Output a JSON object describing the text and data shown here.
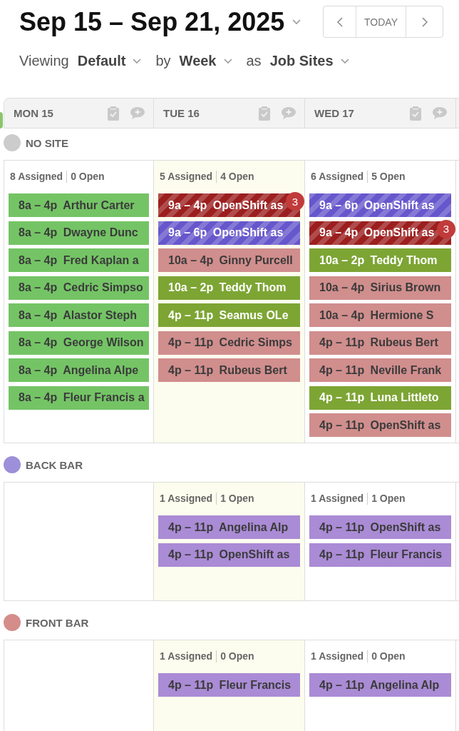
{
  "header": {
    "title": "Sep 15 – Sep 21, 2025",
    "today_button": "TODAY"
  },
  "filters": [
    {
      "label": "Viewing",
      "value": "Default"
    },
    {
      "label": "by",
      "value": "Week"
    },
    {
      "label": "as",
      "value": "Job Sites"
    }
  ],
  "days": [
    {
      "label": "MON 15",
      "today": false
    },
    {
      "label": "TUE 16",
      "today": true
    },
    {
      "label": "WED 17",
      "today": false
    }
  ],
  "sites": [
    {
      "name": "NO SITE",
      "color": "#cccccc",
      "cells": [
        {
          "assigned": "8 Assigned",
          "open": "0 Open",
          "shifts": [
            {
              "time": "8a – 4p",
              "title": "Arthur Carter",
              "color": "#74c465",
              "open_shift": false
            },
            {
              "time": "8a – 4p",
              "title": "Dwayne Dunc",
              "color": "#74c465",
              "open_shift": false
            },
            {
              "time": "8a – 4p",
              "title": "Fred Kaplan a",
              "color": "#74c465",
              "open_shift": false
            },
            {
              "time": "8a – 4p",
              "title": "Cedric Simpso",
              "color": "#74c465",
              "open_shift": false
            },
            {
              "time": "8a – 4p",
              "title": "Alastor Steph",
              "color": "#74c465",
              "open_shift": false
            },
            {
              "time": "8a – 4p",
              "title": "George Wilson",
              "color": "#74c465",
              "open_shift": false
            },
            {
              "time": "8a – 4p",
              "title": "Angelina Alpe",
              "color": "#74c465",
              "open_shift": false
            },
            {
              "time": "8a – 4p",
              "title": "Fleur Francis a",
              "color": "#74c465",
              "open_shift": false
            }
          ]
        },
        {
          "assigned": "5 Assigned",
          "open": "4 Open",
          "shifts": [
            {
              "time": "9a – 4p",
              "title": "OpenShift as",
              "color": "#9c1f1f",
              "open_shift": true,
              "badge": "3"
            },
            {
              "time": "9a – 6p",
              "title": "OpenShift as",
              "color": "#6657cc",
              "open_shift": true
            },
            {
              "time": "10a – 4p",
              "title": "Ginny Purcell",
              "color": "#d08e8d",
              "open_shift": false
            },
            {
              "time": "10a – 2p",
              "title": "Teddy Thom",
              "color": "#7da534",
              "open_shift": false
            },
            {
              "time": "4p – 11p",
              "title": "Seamus OLe",
              "color": "#7da534",
              "open_shift": false
            },
            {
              "time": "4p – 11p",
              "title": "Cedric Simps",
              "color": "#d08e8d",
              "open_shift": false
            },
            {
              "time": "4p – 11p",
              "title": "Rubeus Bert",
              "color": "#d08e8d",
              "open_shift": false
            }
          ]
        },
        {
          "assigned": "6 Assigned",
          "open": "5 Open",
          "shifts": [
            {
              "time": "9a – 6p",
              "title": "OpenShift as",
              "color": "#6657cc",
              "open_shift": true
            },
            {
              "time": "9a – 4p",
              "title": "OpenShift as",
              "color": "#9c1f1f",
              "open_shift": true,
              "badge": "3"
            },
            {
              "time": "10a – 2p",
              "title": "Teddy Thom",
              "color": "#7da534",
              "open_shift": false
            },
            {
              "time": "10a – 4p",
              "title": "Sirius Brown",
              "color": "#d08e8d",
              "open_shift": false
            },
            {
              "time": "10a – 4p",
              "title": "Hermione S",
              "color": "#d08e8d",
              "open_shift": false
            },
            {
              "time": "4p – 11p",
              "title": "Rubeus Bert",
              "color": "#d08e8d",
              "open_shift": false
            },
            {
              "time": "4p – 11p",
              "title": "Neville Frank",
              "color": "#d08e8d",
              "open_shift": false
            },
            {
              "time": "4p – 11p",
              "title": "Luna Littleto",
              "color": "#7da534",
              "open_shift": false
            },
            {
              "time": "4p – 11p",
              "title": "OpenShift as",
              "color": "#d08e8d",
              "open_shift": false
            }
          ]
        }
      ]
    },
    {
      "name": "BACK BAR",
      "color": "#9d8fd9",
      "cells": [
        {},
        {
          "assigned": "1 Assigned",
          "open": "1 Open",
          "shifts": [
            {
              "time": "4p – 11p",
              "title": "Angelina Alp",
              "color": "#aa8bd5",
              "open_shift": false
            },
            {
              "time": "4p – 11p",
              "title": "OpenShift as",
              "color": "#aa8bd5",
              "open_shift": false
            }
          ]
        },
        {
          "assigned": "1 Assigned",
          "open": "1 Open",
          "shifts": [
            {
              "time": "4p – 11p",
              "title": "OpenShift as",
              "color": "#aa8bd5",
              "open_shift": false
            },
            {
              "time": "4p – 11p",
              "title": "Fleur Francis",
              "color": "#aa8bd5",
              "open_shift": false
            }
          ]
        }
      ]
    },
    {
      "name": "FRONT BAR",
      "color": "#d48d8b",
      "cells": [
        {},
        {
          "assigned": "1 Assigned",
          "open": "0 Open",
          "shifts": [
            {
              "time": "4p – 11p",
              "title": "Fleur Francis",
              "color": "#aa8bd5",
              "open_shift": false
            }
          ]
        },
        {
          "assigned": "1 Assigned",
          "open": "0 Open",
          "shifts": [
            {
              "time": "4p – 11p",
              "title": "Angelina Alp",
              "color": "#aa8bd5",
              "open_shift": false
            }
          ]
        }
      ]
    }
  ]
}
